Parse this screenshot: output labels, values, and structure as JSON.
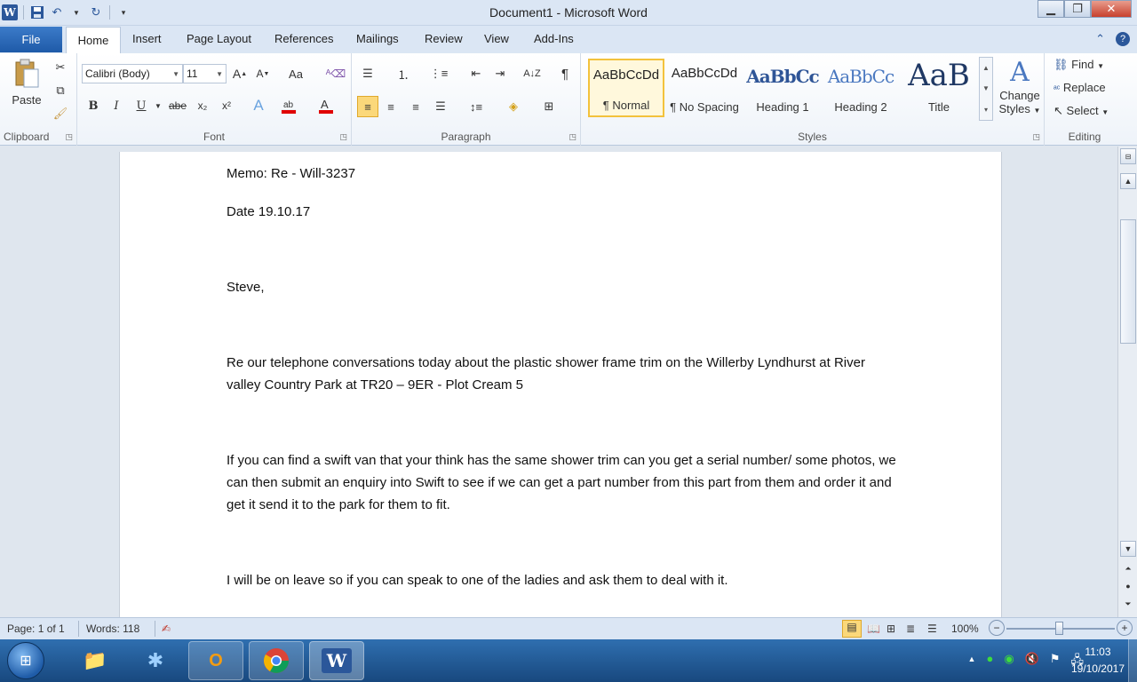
{
  "window": {
    "title": "Document1  -  Microsoft Word",
    "minimize_icon": "minimize-icon",
    "maximize_icon": "restore-icon",
    "close_icon": "close-icon"
  },
  "qat": {
    "app_letter": "W",
    "save": "save-icon",
    "undo": "undo-icon",
    "redo": "redo-icon",
    "customize": "customize-icon"
  },
  "tabs": {
    "file": "File",
    "items": [
      "Home",
      "Insert",
      "Page Layout",
      "References",
      "Mailings",
      "Review",
      "View",
      "Add-Ins"
    ]
  },
  "ribbon": {
    "clipboard": {
      "label": "Clipboard",
      "paste": "Paste"
    },
    "font": {
      "label": "Font",
      "font_name": "Calibri (Body)",
      "font_size": "11",
      "bold": "B",
      "italic": "I",
      "underline": "U",
      "strike": "abe",
      "sub": "x₂",
      "sup": "x²"
    },
    "paragraph": {
      "label": "Paragraph"
    },
    "styles": {
      "label": "Styles",
      "items": [
        {
          "sample": "AaBbCcDd",
          "name": "¶ Normal"
        },
        {
          "sample": "AaBbCcDd",
          "name": "¶ No Spacing"
        },
        {
          "sample": "AaBbCc",
          "name": "Heading 1"
        },
        {
          "sample": "AaBbCc",
          "name": "Heading 2"
        },
        {
          "sample": "AaB",
          "name": "Title"
        }
      ],
      "change_styles_1": "Change",
      "change_styles_2": "Styles"
    },
    "editing": {
      "label": "Editing",
      "find": "Find",
      "replace": "Replace",
      "select": "Select"
    }
  },
  "document": {
    "paragraphs": [
      "Memo: Re - Will-3237",
      "Date 19.10.17",
      "Steve,",
      "Re our telephone conversations today about the plastic shower frame trim on the Willerby Lyndhurst  at River valley Country Park at TR20 – 9ER  - Plot Cream 5",
      "If you can find a swift van that your think has the same shower trim can you get a serial number/ some photos, we can then submit an enquiry into Swift to see if we can get a part number from this part from them and order it and get it send it to the park for them to fit.",
      "I will be on leave so if you can speak to one of the ladies and ask them to deal with it."
    ]
  },
  "status": {
    "page": "Page: 1 of 1",
    "words": "Words: 118",
    "zoom": "100%",
    "zoom_level_percent": 100
  },
  "taskbar": {
    "time": "11:03",
    "date": "19/10/2017"
  },
  "colors": {
    "accent": "#2b579a",
    "highlight_yellow": "#ffff00",
    "font_color_red": "#e00000"
  }
}
